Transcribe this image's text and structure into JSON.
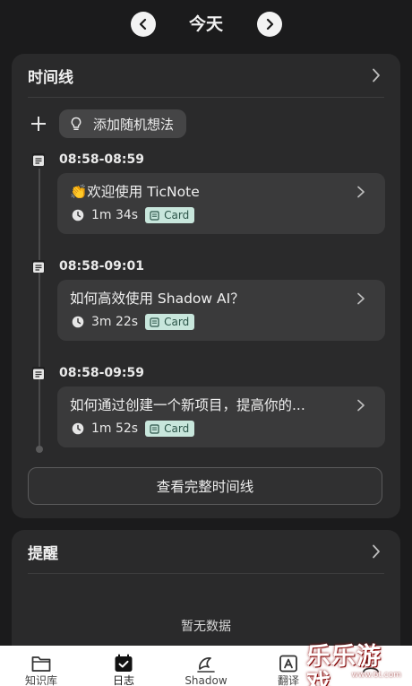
{
  "header": {
    "date_label": "今天",
    "prev_icon": "chevron-left-icon",
    "next_icon": "chevron-right-icon"
  },
  "timeline": {
    "title": "时间线",
    "add_idea_label": "添加随机想法",
    "entries": [
      {
        "time_range": "08:58-08:59",
        "title": "👏欢迎使用 TicNote",
        "duration": "1m 34s",
        "badge": "Card"
      },
      {
        "time_range": "08:58-09:01",
        "title": "如何高效使用 Shadow AI？",
        "duration": "3m 22s",
        "badge": "Card"
      },
      {
        "time_range": "08:58-09:59",
        "title": "如何通过创建一个新项目，提高你的...",
        "duration": "1m 52s",
        "badge": "Card"
      }
    ],
    "view_full_label": "查看完整时间线"
  },
  "reminder": {
    "title": "提醒",
    "empty_label": "暂无数据"
  },
  "tabs": [
    {
      "label": "知识库",
      "icon": "folder-icon"
    },
    {
      "label": "日志",
      "icon": "calendar-check-icon"
    },
    {
      "label": "Shadow",
      "icon": "shadow-icon"
    },
    {
      "label": "翻译",
      "icon": "translate-icon"
    },
    {
      "label": "",
      "icon": "profile-icon"
    }
  ],
  "active_tab": "日志",
  "watermark": {
    "text": "乐乐游戏",
    "url": "www.6t.com"
  },
  "colors": {
    "background": "#1b1b1c",
    "card": "#2a2a2b",
    "entry_box": "#3a3a3b",
    "badge_bg": "#c8e6dc",
    "badge_text": "#2b5448",
    "tabbar": "#ffffff"
  }
}
